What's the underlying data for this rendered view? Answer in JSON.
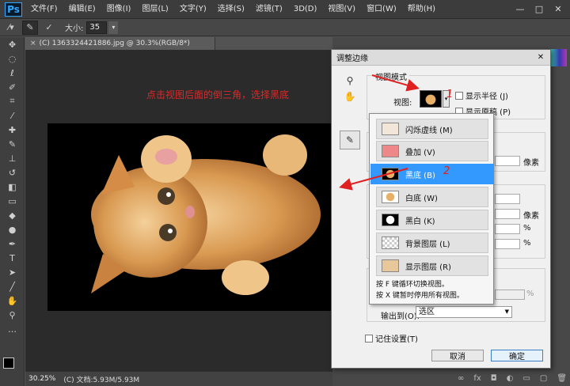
{
  "app": {
    "logo": "Ps"
  },
  "menubar": {
    "items": [
      "文件(F)",
      "编辑(E)",
      "图像(I)",
      "图层(L)",
      "文字(Y)",
      "选择(S)",
      "滤镜(T)",
      "3D(D)",
      "视图(V)",
      "窗口(W)",
      "帮助(H)"
    ],
    "window_controls": [
      "—",
      "□",
      "✕"
    ]
  },
  "options": {
    "size_label": "大小:",
    "size_value": "35"
  },
  "document": {
    "tab_title": "(C) 1363324421886.jpg @ 30.3%(RGB/8*)",
    "tab_close": "×",
    "instruction": "点击视图后面的倒三角，选择黑底",
    "zoom": "30.25%",
    "doc_info": "(C) 文档:5.93M/5.93M"
  },
  "colors": {
    "foreground": "#000000",
    "background": "#2bb34a",
    "annotation": "#e02020",
    "selection": "#3399ff"
  },
  "dialog": {
    "title": "调整边缘",
    "close": "✕",
    "view_mode_title": "视图模式",
    "view_label": "视图:",
    "show_radius": "显示半径 (J)",
    "show_original": "显示原稿 (P)",
    "unit_px": "像素",
    "unit_pct": "%",
    "output_to_label": "输出到(O):",
    "output_to_value": "选区",
    "remember_settings": "记住设置(T)",
    "cancel": "取消",
    "ok": "确定"
  },
  "view_menu": {
    "options": [
      {
        "label": "闪烁虚线 (M)",
        "thumb": "marching-ants"
      },
      {
        "label": "叠加 (V)",
        "thumb": "overlay"
      },
      {
        "label": "黑底 (B)",
        "thumb": "on-black"
      },
      {
        "label": "白底 (W)",
        "thumb": "on-white"
      },
      {
        "label": "黑白 (K)",
        "thumb": "black-white"
      },
      {
        "label": "背景图层 (L)",
        "thumb": "on-layers"
      },
      {
        "label": "显示图层 (R)",
        "thumb": "reveal-layer"
      }
    ],
    "selected_index": 2,
    "hint1": "按 F 键循环切换视图。",
    "hint2": "按 X 键暂时停用所有视图。"
  },
  "annotations": {
    "step1": "1",
    "step2": "2"
  }
}
